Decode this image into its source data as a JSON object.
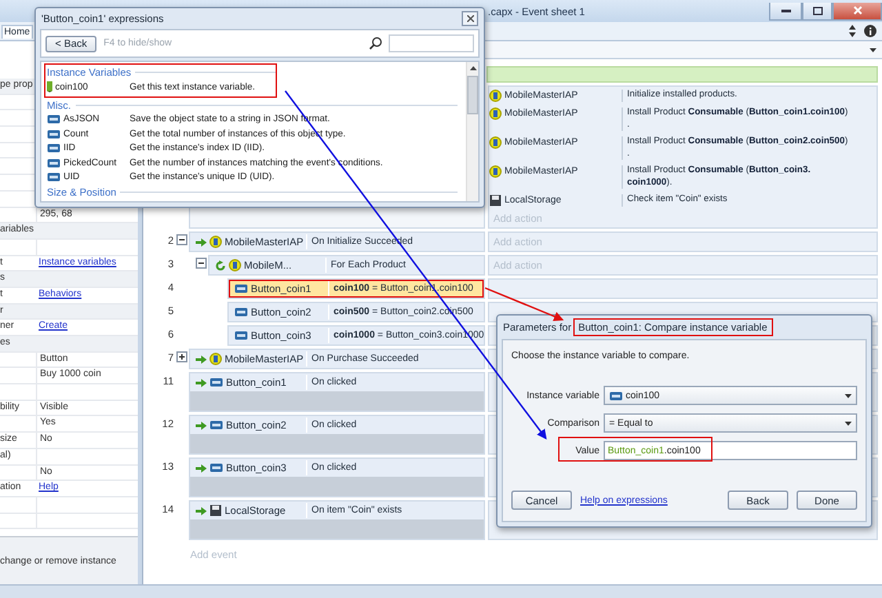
{
  "window": {
    "title": ".capx - Event sheet 1"
  },
  "ribbon": {
    "tabs": [
      {
        "label": "Home",
        "selected": true
      }
    ]
  },
  "properties": {
    "rows": [
      {
        "kind": "header",
        "label": "pe prop"
      },
      {
        "kind": "row"
      },
      {
        "kind": "row"
      },
      {
        "kind": "row"
      },
      {
        "kind": "row"
      },
      {
        "kind": "row"
      },
      {
        "kind": "row"
      },
      {
        "kind": "row"
      },
      {
        "kind": "row",
        "value": "295, 68"
      },
      {
        "kind": "header",
        "label": "ariables"
      },
      {
        "kind": "row"
      },
      {
        "kind": "link",
        "label": "t",
        "value": "Instance variables"
      },
      {
        "kind": "header",
        "label": "s"
      },
      {
        "kind": "link",
        "label": "t",
        "value": "Behaviors"
      },
      {
        "kind": "header",
        "label": "r"
      },
      {
        "kind": "link",
        "label": "ner",
        "value": "Create"
      },
      {
        "kind": "header",
        "label": "es"
      },
      {
        "kind": "row",
        "value": "Button"
      },
      {
        "kind": "row",
        "value": "Buy 1000 coin"
      },
      {
        "kind": "row"
      },
      {
        "kind": "row",
        "label": "bility",
        "value": "Visible"
      },
      {
        "kind": "row",
        "value": "Yes"
      },
      {
        "kind": "row",
        "label": "size",
        "value": "No"
      },
      {
        "kind": "row",
        "label": "al)"
      },
      {
        "kind": "row",
        "value": "No"
      },
      {
        "kind": "link",
        "label": "ation",
        "value": "Help"
      },
      {
        "kind": "row"
      },
      {
        "kind": "row"
      }
    ],
    "description": "change or remove instance"
  },
  "event_sheet": {
    "events": [
      {
        "selected": false,
        "add_action": "Add action",
        "actions": [
          {
            "object": "MobileMasterIAP",
            "kind": "plugin",
            "text": "Initialize installed products."
          },
          {
            "object": "MobileMasterIAP",
            "kind": "plugin",
            "text": "Install Product **Consumable** (**Button_coin1.coin100**)\n."
          },
          {
            "object": "MobileMasterIAP",
            "kind": "plugin",
            "text": "Install Product **Consumable** (**Button_coin2.coin500**)\n."
          },
          {
            "object": "MobileMasterIAP",
            "kind": "plugin",
            "text": "Install Product **Consumable** (**Button_coin3.\ncoin1000**)."
          },
          {
            "object": "LocalStorage",
            "kind": "storage",
            "text": "Check item \"Coin\" exists"
          }
        ]
      },
      {
        "number": "2",
        "kind": "trigger",
        "expanded": true,
        "selected": false,
        "add_action": "Add action",
        "conditions": [
          {
            "object": "MobileMasterIAP",
            "kind": "plugin",
            "text": "On Initialize Succeeded"
          }
        ],
        "children": [
          {
            "number": "3",
            "kind": "loop",
            "expanded": true,
            "selected": false,
            "add_action": "Add action",
            "conditions": [
              {
                "object": "MobileM...",
                "kind": "plugin",
                "text": "For Each Product"
              }
            ],
            "children": [
              {
                "number": "4",
                "selected": true,
                "conditions": [
                  {
                    "object": "Button_coin1",
                    "kind": "button",
                    "text": "**coin100** = Button_coin1.coin100"
                  }
                ]
              },
              {
                "number": "5",
                "selected": false,
                "conditions": [
                  {
                    "object": "Button_coin2",
                    "kind": "button",
                    "text": "**coin500** = Button_coin2.coin500"
                  }
                ]
              },
              {
                "number": "6",
                "selected": false,
                "conditions": [
                  {
                    "object": "Button_coin3",
                    "kind": "button",
                    "text": "**coin1000** = Button_coin3.coin1000"
                  }
                ]
              }
            ]
          }
        ]
      },
      {
        "number": "7",
        "kind": "trigger",
        "expanded": false,
        "selected": false,
        "conditions": [
          {
            "object": "MobileMasterIAP",
            "kind": "plugin",
            "text": "On Purchase Succeeded"
          }
        ]
      },
      {
        "number": "11",
        "kind": "trigger",
        "selected": false,
        "conditions": [
          {
            "object": "Button_coin1",
            "kind": "button",
            "text": "On clicked"
          }
        ]
      },
      {
        "number": "12",
        "kind": "trigger",
        "selected": false,
        "conditions": [
          {
            "object": "Button_coin2",
            "kind": "button",
            "text": "On clicked"
          }
        ]
      },
      {
        "number": "13",
        "kind": "trigger",
        "selected": false,
        "conditions": [
          {
            "object": "Button_coin3",
            "kind": "button",
            "text": "On clicked"
          }
        ]
      },
      {
        "number": "14",
        "kind": "trigger",
        "selected": false,
        "conditions": [
          {
            "object": "LocalStorage",
            "kind": "storage",
            "text": "On item \"Coin\" exists"
          }
        ]
      }
    ],
    "add_event": "Add event"
  },
  "expressions_dialog": {
    "title": "'Button_coin1' expressions",
    "back": "< Back",
    "hint": "F4 to hide/show",
    "sections": [
      {
        "title": "Instance Variables",
        "items": [
          {
            "name": "coin100",
            "kind": "variable",
            "description": "Get this text instance variable."
          }
        ]
      },
      {
        "title": "Misc.",
        "items": [
          {
            "name": "AsJSON",
            "kind": "button",
            "description": "Save the object state to a string in JSON format."
          },
          {
            "name": "Count",
            "kind": "button",
            "description": "Get the total number of instances of this object type."
          },
          {
            "name": "IID",
            "kind": "button",
            "description": "Get the instance's index ID (IID)."
          },
          {
            "name": "PickedCount",
            "kind": "button",
            "description": "Get the number of instances matching the event's conditions."
          },
          {
            "name": "UID",
            "kind": "button",
            "description": "Get the instance's unique ID (UID)."
          }
        ]
      },
      {
        "title": "Size & Position"
      }
    ]
  },
  "parameters_dialog": {
    "title_prefix": "Parameters for",
    "title": "Button_coin1: Compare instance variable",
    "instruction": "Choose the instance variable to compare.",
    "fields": [
      {
        "label": "Instance variable",
        "kind": "variable-select",
        "value": "coin100"
      },
      {
        "label": "Comparison",
        "kind": "select",
        "value": "= Equal to"
      },
      {
        "label": "Value",
        "kind": "input",
        "parts": [
          {
            "text": "Button_coin1",
            "kind": "object"
          },
          {
            "text": ".coin100",
            "kind": "plain"
          }
        ]
      }
    ],
    "buttons": [
      {
        "label": "Cancel",
        "kind": "button"
      },
      {
        "label": "Help on expressions",
        "kind": "link"
      },
      {
        "label": "Back",
        "kind": "button"
      },
      {
        "label": "Done",
        "kind": "button"
      }
    ]
  }
}
